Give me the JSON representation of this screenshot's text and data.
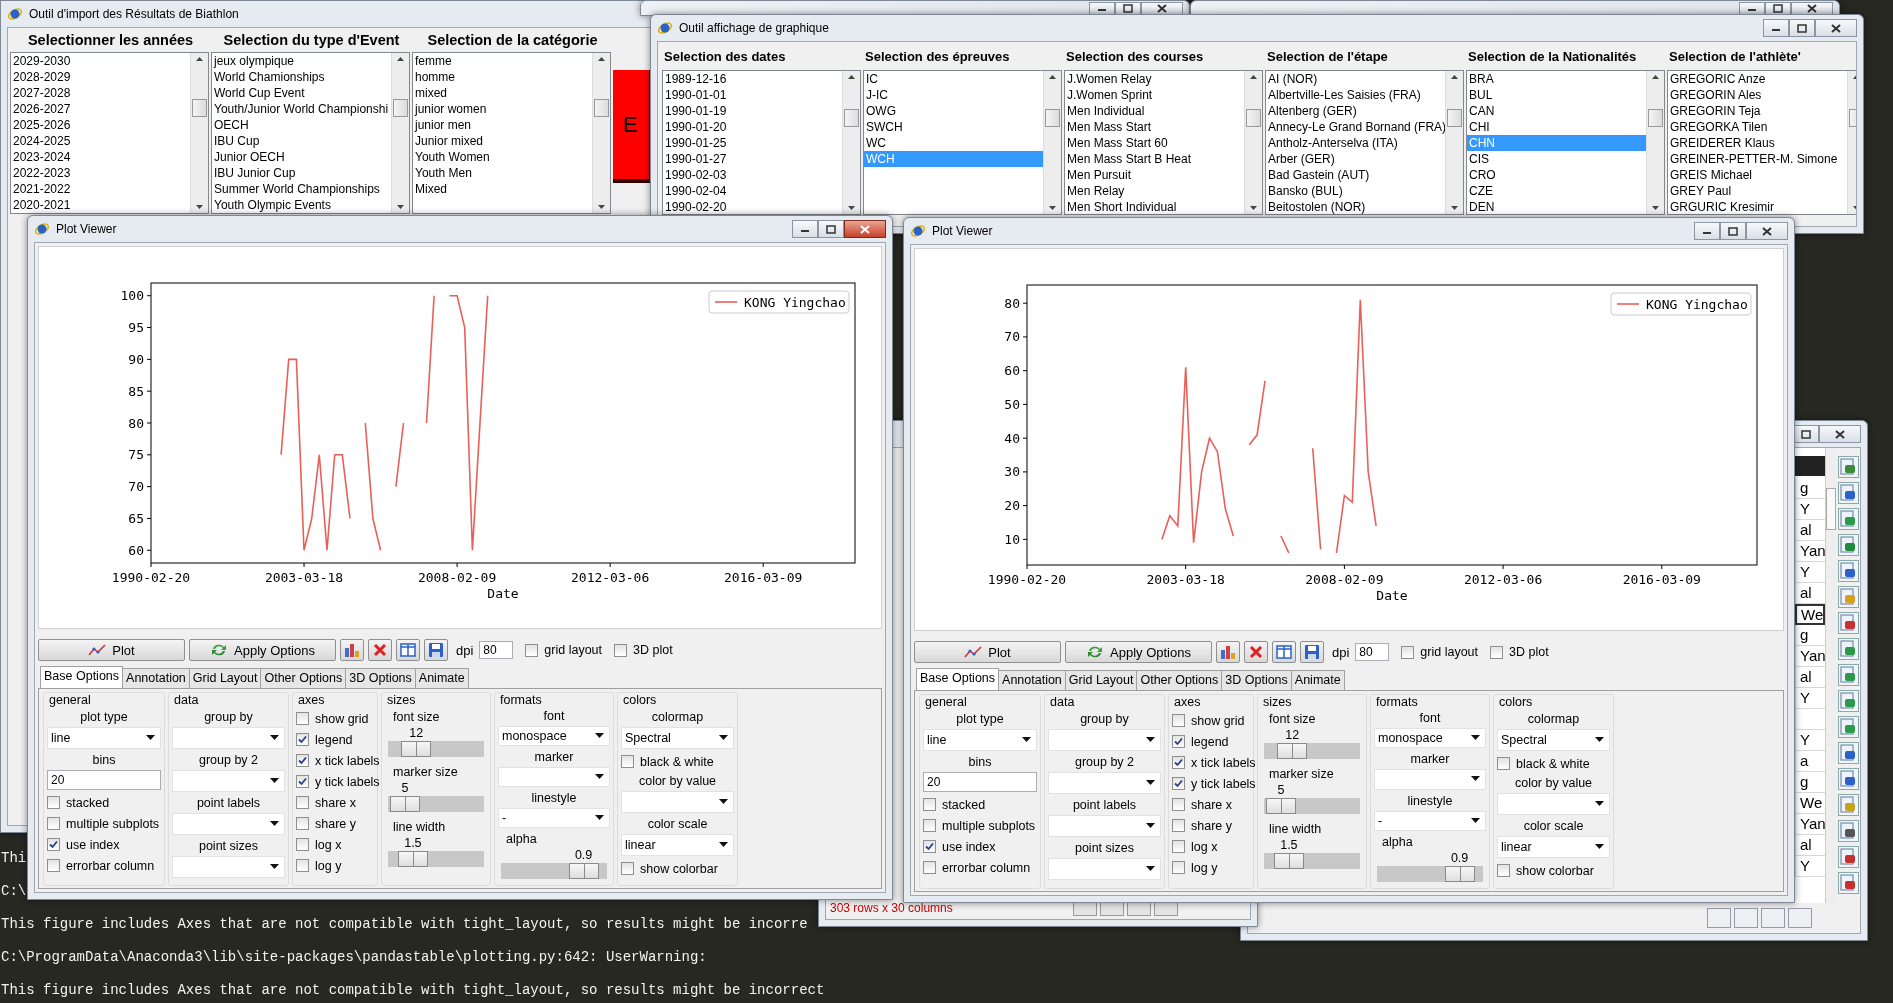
{
  "import_window": {
    "title": "Outil d'import des Résultats de Biathlon",
    "columns": [
      {
        "header": "Selectionner les années",
        "items": [
          {
            "text": "2029-2030",
            "selected": false
          },
          {
            "text": "2028-2029",
            "selected": false
          },
          {
            "text": "2027-2028",
            "selected": false
          },
          {
            "text": "2026-2027",
            "selected": false
          },
          {
            "text": "2025-2026",
            "selected": false
          },
          {
            "text": "2024-2025",
            "selected": false
          },
          {
            "text": "2023-2024",
            "selected": false
          },
          {
            "text": "2022-2023",
            "selected": false
          },
          {
            "text": "2021-2022",
            "selected": false
          },
          {
            "text": "2020-2021",
            "selected": false
          }
        ]
      },
      {
        "header": "Selection du type d'Event",
        "items": [
          {
            "text": "jeux olympique",
            "selected": false
          },
          {
            "text": "World Chamionships",
            "selected": false
          },
          {
            "text": "World Cup Event",
            "selected": false
          },
          {
            "text": "Youth/Junior World Championshi",
            "selected": false
          },
          {
            "text": "OECH",
            "selected": false
          },
          {
            "text": "IBU Cup",
            "selected": false
          },
          {
            "text": "Junior OECH",
            "selected": false
          },
          {
            "text": "IBU Junior Cup",
            "selected": false
          },
          {
            "text": "Summer World Championships",
            "selected": false
          },
          {
            "text": "Youth Olympic Events",
            "selected": false
          }
        ]
      },
      {
        "header": "Selection de la catégorie",
        "items": [
          {
            "text": "femme",
            "selected": false
          },
          {
            "text": "homme",
            "selected": false
          },
          {
            "text": "mixed",
            "selected": false
          },
          {
            "text": "junior women",
            "selected": false
          },
          {
            "text": "junior men",
            "selected": false
          },
          {
            "text": "Junior mixed",
            "selected": false
          },
          {
            "text": "Youth Women",
            "selected": false
          },
          {
            "text": "Youth Men",
            "selected": false
          },
          {
            "text": "Mixed",
            "selected": false
          }
        ]
      }
    ],
    "action_button": "E"
  },
  "graph_window": {
    "title": "Outil affichage de graphique",
    "columns": [
      {
        "header": "Selection des dates",
        "items": [
          {
            "text": "1989-12-16",
            "selected": false
          },
          {
            "text": "1990-01-01",
            "selected": false
          },
          {
            "text": "1990-01-19",
            "selected": false
          },
          {
            "text": "1990-01-20",
            "selected": false
          },
          {
            "text": "1990-01-25",
            "selected": false
          },
          {
            "text": "1990-01-27",
            "selected": false
          },
          {
            "text": "1990-02-03",
            "selected": false
          },
          {
            "text": "1990-02-04",
            "selected": false
          },
          {
            "text": "1990-02-20",
            "selected": false
          }
        ]
      },
      {
        "header": "Selection des épreuves",
        "items": [
          {
            "text": "IC",
            "selected": false
          },
          {
            "text": "J-IC",
            "selected": false
          },
          {
            "text": "OWG",
            "selected": false
          },
          {
            "text": "SWCH",
            "selected": false
          },
          {
            "text": "WC",
            "selected": false
          },
          {
            "text": "WCH",
            "selected": true
          }
        ]
      },
      {
        "header": "Selection des courses",
        "items": [
          {
            "text": "J.Women Relay",
            "selected": false
          },
          {
            "text": "J.Women Sprint",
            "selected": false
          },
          {
            "text": "Men Individual",
            "selected": false
          },
          {
            "text": "Men Mass Start",
            "selected": false
          },
          {
            "text": "Men Mass Start 60",
            "selected": false
          },
          {
            "text": "Men Mass Start B Heat",
            "selected": false
          },
          {
            "text": "Men Pursuit",
            "selected": false
          },
          {
            "text": "Men Relay",
            "selected": false
          },
          {
            "text": "Men Short Individual",
            "selected": false
          }
        ]
      },
      {
        "header": "Selection de l'étape",
        "items": [
          {
            "text": "AI (NOR)",
            "selected": false
          },
          {
            "text": "Albertville-Les Saisies (FRA)",
            "selected": false
          },
          {
            "text": "Altenberg (GER)",
            "selected": false
          },
          {
            "text": "Annecy-Le Grand Bornand (FRA)",
            "selected": false
          },
          {
            "text": "Antholz-Anterselva (ITA)",
            "selected": false
          },
          {
            "text": "Arber (GER)",
            "selected": false
          },
          {
            "text": "Bad Gastein (AUT)",
            "selected": false
          },
          {
            "text": "Bansko (BUL)",
            "selected": false
          },
          {
            "text": "Beitostolen (NOR)",
            "selected": false
          }
        ]
      },
      {
        "header": "Selection de la Nationalités",
        "items": [
          {
            "text": "BRA",
            "selected": false
          },
          {
            "text": "BUL",
            "selected": false
          },
          {
            "text": "CAN",
            "selected": false
          },
          {
            "text": "CHI",
            "selected": false
          },
          {
            "text": "CHN",
            "selected": true
          },
          {
            "text": "CIS",
            "selected": false
          },
          {
            "text": "CRO",
            "selected": false
          },
          {
            "text": "CZE",
            "selected": false
          },
          {
            "text": "DEN",
            "selected": false
          }
        ]
      },
      {
        "header": "Selection de l'athlète'",
        "items": [
          {
            "text": "GREGORIC Anze",
            "selected": false
          },
          {
            "text": "GREGORIN Ales",
            "selected": false
          },
          {
            "text": "GREGORIN Teja",
            "selected": false
          },
          {
            "text": "GREGORKA Tilen",
            "selected": false
          },
          {
            "text": "GREIDERER Klaus",
            "selected": false
          },
          {
            "text": "GREINER-PETTER-M. Simone",
            "selected": false
          },
          {
            "text": "GREIS Michael",
            "selected": false
          },
          {
            "text": "GREY Paul",
            "selected": false
          },
          {
            "text": "GRGURIC Kresimir",
            "selected": false
          }
        ]
      }
    ]
  },
  "table_window": {
    "cells": [
      {
        "text": "g",
        "selected": false
      },
      {
        "text": "Y",
        "selected": false
      },
      {
        "text": "al",
        "selected": false
      },
      {
        "text": "Yan",
        "selected": false
      },
      {
        "text": "Y",
        "selected": false
      },
      {
        "text": "al",
        "selected": false
      },
      {
        "text": "We",
        "selected": true
      },
      {
        "text": "g",
        "selected": false
      },
      {
        "text": "Yan",
        "selected": false
      },
      {
        "text": "al",
        "selected": false
      },
      {
        "text": "Y",
        "selected": false
      },
      {
        "text": "",
        "selected": false
      },
      {
        "text": "Y",
        "selected": false
      },
      {
        "text": "a",
        "selected": false
      },
      {
        "text": "g",
        "selected": false
      },
      {
        "text": "We",
        "selected": false
      },
      {
        "text": "Yan",
        "selected": false
      },
      {
        "text": "al",
        "selected": false
      },
      {
        "text": "Y",
        "selected": false
      }
    ]
  },
  "data_window": {
    "status": "303 rows x 30 columns"
  },
  "plot_viewers": [
    {
      "title": "Plot Viewer",
      "active": true,
      "chart_data": {
        "type": "line",
        "xlabel": "Date",
        "categories": [
          "1990-02-20",
          null,
          null,
          null,
          null,
          null,
          null,
          null,
          null,
          null,
          null,
          null,
          null,
          null,
          null,
          null,
          null,
          null,
          null,
          null,
          "2003-03-18",
          null,
          null,
          null,
          null,
          null,
          null,
          null,
          null,
          null,
          null,
          null,
          null,
          null,
          null,
          null,
          null,
          null,
          null,
          null,
          "2008-02-09",
          null,
          null,
          null,
          null,
          null,
          null,
          null,
          null,
          null,
          null,
          null,
          null,
          null,
          null,
          null,
          null,
          null,
          null,
          null,
          "2012-03-06",
          null,
          null,
          null,
          null,
          null,
          null,
          null,
          null,
          null,
          null,
          null,
          null,
          null,
          null,
          null,
          null,
          null,
          null,
          null,
          "2016-03-09",
          null,
          null,
          null,
          null,
          null,
          null,
          null,
          null,
          null,
          null,
          null,
          null
        ],
        "series": [
          {
            "name": "KONG Yingchao",
            "color": "#e8605a",
            "values": [
              null,
              null,
              null,
              null,
              null,
              null,
              null,
              null,
              null,
              null,
              null,
              null,
              null,
              null,
              null,
              null,
              null,
              75,
              90,
              90,
              60,
              65,
              75,
              60,
              75,
              75,
              65,
              null,
              80,
              65,
              60,
              null,
              70,
              80,
              null,
              null,
              80,
              100,
              null,
              100,
              100,
              95,
              60,
              80,
              100,
              null,
              null,
              null,
              null,
              null,
              null,
              null,
              null,
              null,
              null,
              null,
              null,
              null,
              null,
              null,
              null,
              null,
              null,
              null,
              null,
              null,
              null,
              null,
              null,
              null,
              null,
              null,
              null,
              null,
              null,
              null,
              null,
              null,
              null,
              null,
              null,
              null,
              null,
              null,
              null,
              null,
              null,
              null,
              null,
              null,
              null,
              null,
              null
            ]
          }
        ],
        "ylim": [
          58,
          102
        ],
        "yticks": [
          60,
          65,
          70,
          75,
          80,
          85,
          90,
          95,
          100
        ]
      },
      "toolbar": {
        "plot": "Plot",
        "apply": "Apply Options",
        "dpi_label": "dpi",
        "dpi": "80",
        "grid_layout": {
          "label": "grid layout",
          "checked": false
        },
        "plot_3d": {
          "label": "3D plot",
          "checked": false
        }
      },
      "tabs": [
        {
          "label": "Base Options",
          "selected": true
        },
        {
          "label": "Annotation",
          "selected": false
        },
        {
          "label": "Grid Layout",
          "selected": false
        },
        {
          "label": "Other Options",
          "selected": false
        },
        {
          "label": "3D Options",
          "selected": false
        },
        {
          "label": "Animate",
          "selected": false
        }
      ],
      "option_groups": [
        {
          "title": "general",
          "items": [
            {
              "kind": "label",
              "text": "plot type"
            },
            {
              "kind": "dropdown",
              "value": "line"
            },
            {
              "kind": "label",
              "text": "bins"
            },
            {
              "kind": "field",
              "value": "20"
            },
            {
              "kind": "check",
              "label": "stacked",
              "checked": false
            },
            {
              "kind": "check",
              "label": "multiple subplots",
              "checked": false
            },
            {
              "kind": "check",
              "label": "use index",
              "checked": true
            },
            {
              "kind": "check",
              "label": "errorbar column",
              "checked": false
            }
          ]
        },
        {
          "title": "data",
          "items": [
            {
              "kind": "label",
              "text": "group by"
            },
            {
              "kind": "dropdown"
            },
            {
              "kind": "label",
              "text": "group by 2"
            },
            {
              "kind": "dropdown"
            },
            {
              "kind": "label",
              "text": "point labels"
            },
            {
              "kind": "dropdown"
            },
            {
              "kind": "label",
              "text": "point sizes"
            },
            {
              "kind": "dropdown"
            }
          ]
        },
        {
          "title": "axes",
          "items": [
            {
              "kind": "check",
              "label": "show grid",
              "checked": false
            },
            {
              "kind": "check",
              "label": "legend",
              "checked": true
            },
            {
              "kind": "check",
              "label": "x tick labels",
              "checked": true
            },
            {
              "kind": "check",
              "label": "y tick labels",
              "checked": true
            },
            {
              "kind": "check",
              "label": "share x",
              "checked": false
            },
            {
              "kind": "check",
              "label": "share y",
              "checked": false
            },
            {
              "kind": "check",
              "label": "log x",
              "checked": false
            },
            {
              "kind": "check",
              "label": "log y",
              "checked": false
            }
          ]
        },
        {
          "title": "sizes",
          "items": [
            {
              "kind": "slider",
              "label": "font size",
              "reading": "12",
              "level": 0.2
            },
            {
              "kind": "slider",
              "label": "marker size",
              "reading": "5",
              "level": 0.03
            },
            {
              "kind": "slider",
              "label": "line width",
              "reading": "1.5",
              "level": 0.15
            }
          ]
        },
        {
          "title": "formats",
          "items": [
            {
              "kind": "label",
              "text": "font"
            },
            {
              "kind": "dropdown",
              "value": "monospace"
            },
            {
              "kind": "label",
              "text": "marker"
            },
            {
              "kind": "dropdown"
            },
            {
              "kind": "label",
              "text": "linestyle"
            },
            {
              "kind": "dropdown",
              "value": "-"
            },
            {
              "kind": "slider",
              "label": "alpha",
              "reading": "0.9",
              "level": 0.89
            }
          ]
        },
        {
          "title": "colors",
          "items": [
            {
              "kind": "label",
              "text": "colormap"
            },
            {
              "kind": "dropdown",
              "value": "Spectral"
            },
            {
              "kind": "check",
              "label": "black & white",
              "checked": false
            },
            {
              "kind": "label",
              "text": "color by value"
            },
            {
              "kind": "dropdown"
            },
            {
              "kind": "label",
              "text": "color scale"
            },
            {
              "kind": "dropdown",
              "value": "linear"
            },
            {
              "kind": "check",
              "label": "show colorbar",
              "checked": false
            }
          ]
        }
      ]
    },
    {
      "title": "Plot Viewer",
      "active": false,
      "chart_data": {
        "type": "line",
        "xlabel": "Date",
        "categories": [
          "1990-02-20",
          null,
          null,
          null,
          null,
          null,
          null,
          null,
          null,
          null,
          null,
          null,
          null,
          null,
          null,
          null,
          null,
          null,
          null,
          null,
          "2003-03-18",
          null,
          null,
          null,
          null,
          null,
          null,
          null,
          null,
          null,
          null,
          null,
          null,
          null,
          null,
          null,
          null,
          null,
          null,
          null,
          "2008-02-09",
          null,
          null,
          null,
          null,
          null,
          null,
          null,
          null,
          null,
          null,
          null,
          null,
          null,
          null,
          null,
          null,
          null,
          null,
          null,
          "2012-03-06",
          null,
          null,
          null,
          null,
          null,
          null,
          null,
          null,
          null,
          null,
          null,
          null,
          null,
          null,
          null,
          null,
          null,
          null,
          null,
          "2016-03-09",
          null,
          null,
          null,
          null,
          null,
          null,
          null,
          null,
          null,
          null,
          null,
          null
        ],
        "series": [
          {
            "name": "KONG Yingchao",
            "color": "#e8605a",
            "values": [
              null,
              null,
              null,
              null,
              null,
              null,
              null,
              null,
              null,
              null,
              null,
              null,
              null,
              null,
              null,
              null,
              null,
              10,
              17,
              14,
              61,
              9,
              30,
              40,
              36,
              19,
              11,
              null,
              38,
              41,
              57,
              null,
              11,
              6,
              null,
              null,
              37,
              7,
              null,
              6,
              23,
              21,
              81,
              30,
              14,
              null,
              null,
              null,
              null,
              null,
              null,
              null,
              null,
              null,
              null,
              null,
              null,
              null,
              null,
              null,
              null,
              null,
              null,
              null,
              null,
              null,
              null,
              null,
              null,
              null,
              null,
              null,
              null,
              null,
              null,
              null,
              null,
              null,
              null,
              null,
              null,
              null,
              null,
              null,
              null,
              null,
              null,
              null,
              null,
              null,
              null,
              null,
              null
            ]
          }
        ],
        "ylim": [
          2.4,
          85.4
        ],
        "yticks": [
          10,
          20,
          30,
          40,
          50,
          60,
          70,
          80
        ]
      },
      "toolbar": {
        "plot": "Plot",
        "apply": "Apply Options",
        "dpi_label": "dpi",
        "dpi": "80",
        "grid_layout": {
          "label": "grid layout",
          "checked": false
        },
        "plot_3d": {
          "label": "3D plot",
          "checked": false
        }
      },
      "tabs": [
        {
          "label": "Base Options",
          "selected": true
        },
        {
          "label": "Annotation",
          "selected": false
        },
        {
          "label": "Grid Layout",
          "selected": false
        },
        {
          "label": "Other Options",
          "selected": false
        },
        {
          "label": "3D Options",
          "selected": false
        },
        {
          "label": "Animate",
          "selected": false
        }
      ],
      "option_groups": [
        {
          "title": "general",
          "items": [
            {
              "kind": "label",
              "text": "plot type"
            },
            {
              "kind": "dropdown",
              "value": "line"
            },
            {
              "kind": "label",
              "text": "bins"
            },
            {
              "kind": "field",
              "value": "20"
            },
            {
              "kind": "check",
              "label": "stacked",
              "checked": false
            },
            {
              "kind": "check",
              "label": "multiple subplots",
              "checked": false
            },
            {
              "kind": "check",
              "label": "use index",
              "checked": true
            },
            {
              "kind": "check",
              "label": "errorbar column",
              "checked": false
            }
          ]
        },
        {
          "title": "data",
          "items": [
            {
              "kind": "label",
              "text": "group by"
            },
            {
              "kind": "dropdown"
            },
            {
              "kind": "label",
              "text": "group by 2"
            },
            {
              "kind": "dropdown"
            },
            {
              "kind": "label",
              "text": "point labels"
            },
            {
              "kind": "dropdown"
            },
            {
              "kind": "label",
              "text": "point sizes"
            },
            {
              "kind": "dropdown"
            }
          ]
        },
        {
          "title": "axes",
          "items": [
            {
              "kind": "check",
              "label": "show grid",
              "checked": false
            },
            {
              "kind": "check",
              "label": "legend",
              "checked": true
            },
            {
              "kind": "check",
              "label": "x tick labels",
              "checked": true
            },
            {
              "kind": "check",
              "label": "y tick labels",
              "checked": true
            },
            {
              "kind": "check",
              "label": "share x",
              "checked": false
            },
            {
              "kind": "check",
              "label": "share y",
              "checked": false
            },
            {
              "kind": "check",
              "label": "log x",
              "checked": false
            },
            {
              "kind": "check",
              "label": "log y",
              "checked": false
            }
          ]
        },
        {
          "title": "sizes",
          "items": [
            {
              "kind": "slider",
              "label": "font size",
              "reading": "12",
              "level": 0.2
            },
            {
              "kind": "slider",
              "label": "marker size",
              "reading": "5",
              "level": 0.03
            },
            {
              "kind": "slider",
              "label": "line width",
              "reading": "1.5",
              "level": 0.15
            }
          ]
        },
        {
          "title": "formats",
          "items": [
            {
              "kind": "label",
              "text": "font"
            },
            {
              "kind": "dropdown",
              "value": "monospace"
            },
            {
              "kind": "label",
              "text": "marker"
            },
            {
              "kind": "dropdown"
            },
            {
              "kind": "label",
              "text": "linestyle"
            },
            {
              "kind": "dropdown",
              "value": "-"
            },
            {
              "kind": "slider",
              "label": "alpha",
              "reading": "0.9",
              "level": 0.89
            }
          ]
        },
        {
          "title": "colors",
          "items": [
            {
              "kind": "label",
              "text": "colormap"
            },
            {
              "kind": "dropdown",
              "value": "Spectral"
            },
            {
              "kind": "check",
              "label": "black & white",
              "checked": false
            },
            {
              "kind": "label",
              "text": "color by value"
            },
            {
              "kind": "dropdown"
            },
            {
              "kind": "label",
              "text": "color scale"
            },
            {
              "kind": "dropdown",
              "value": "linear"
            },
            {
              "kind": "check",
              "label": "show colorbar",
              "checked": false
            }
          ]
        }
      ]
    }
  ],
  "console": {
    "lines": [
      "Thi",
      "C:\\",
      "This figure includes Axes that are not compatible with tight_layout, so results might be incorre",
      "C:\\ProgramData\\Anaconda3\\lib\\site-packages\\pandastable\\plotting.py:642: UserWarning:",
      "This figure includes Axes that are not compatible with tight_layout, so results might be incorrect"
    ]
  }
}
